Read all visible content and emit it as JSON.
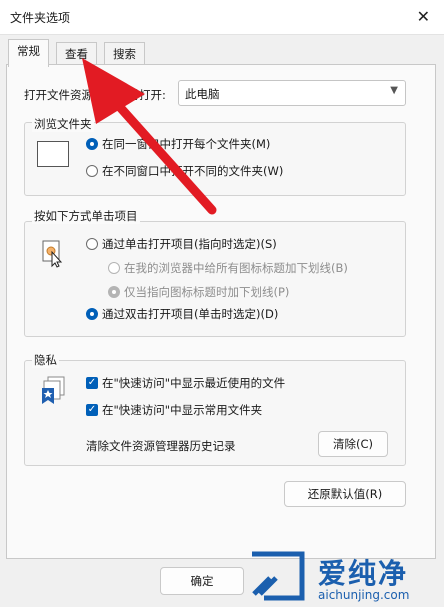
{
  "window": {
    "title": "文件夹选项",
    "close_glyph": "✕"
  },
  "tabs": [
    {
      "label": "常规",
      "active": true
    },
    {
      "label": "查看",
      "active": false
    },
    {
      "label": "搜索",
      "active": false
    }
  ],
  "open_explorer": {
    "label": "打开文件资源管理器时打开:",
    "value": "此电脑"
  },
  "browse_folders": {
    "title": "浏览文件夹",
    "options": [
      {
        "label": "在同一窗口中打开每个文件夹(M)",
        "selected": true
      },
      {
        "label": "在不同窗口中打开不同的文件夹(W)",
        "selected": false
      }
    ]
  },
  "click_items": {
    "title": "按如下方式单击项目",
    "single_click": {
      "label": "通过单击打开项目(指向时选定)(S)",
      "selected": false
    },
    "sub_options": [
      {
        "label": "在我的浏览器中给所有图标标题加下划线(B)",
        "selected": false,
        "disabled": true
      },
      {
        "label": "仅当指向图标标题时加下划线(P)",
        "selected": true,
        "disabled": true
      }
    ],
    "double_click": {
      "label": "通过双击打开项目(单击时选定)(D)",
      "selected": true
    }
  },
  "privacy": {
    "title": "隐私",
    "checks": [
      {
        "label": "在\"快速访问\"中显示最近使用的文件",
        "checked": true
      },
      {
        "label": "在\"快速访问\"中显示常用文件夹",
        "checked": true
      }
    ],
    "clear_label": "清除文件资源管理器历史记录",
    "clear_button": "清除(C)"
  },
  "restore_button": "还原默认值(R)",
  "ok_button": "确定",
  "watermark": {
    "cn": "爱纯净",
    "url": "aichunjing.com"
  },
  "colors": {
    "accent": "#005fb8",
    "arrow": "#e21b23",
    "watermark": "#1b5fae"
  }
}
